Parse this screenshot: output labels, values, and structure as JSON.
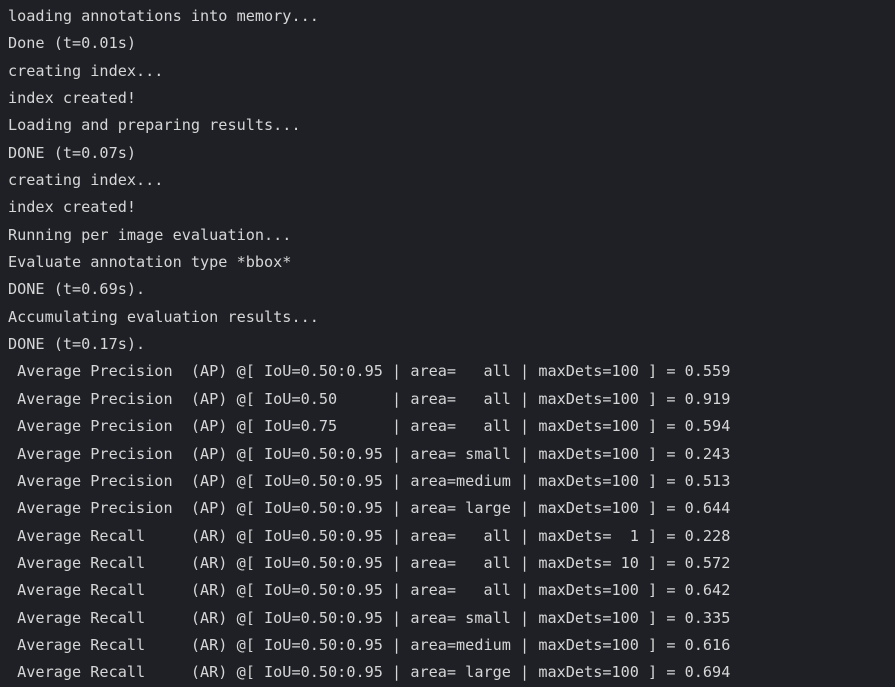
{
  "terminal": {
    "background_color": "#1e2025",
    "text_color": "#d6d6d6",
    "lines": [
      {
        "text": "loading annotations into memory..."
      },
      {
        "text": "Done (t=0.01s)"
      },
      {
        "text": "creating index..."
      },
      {
        "text": "index created!"
      },
      {
        "text": "Loading and preparing results..."
      },
      {
        "text": "DONE (t=0.07s)"
      },
      {
        "text": "creating index..."
      },
      {
        "text": "index created!"
      },
      {
        "text": "Running per image evaluation..."
      },
      {
        "text": "Evaluate annotation type *bbox*"
      },
      {
        "text": "DONE (t=0.69s)."
      },
      {
        "text": "Accumulating evaluation results..."
      },
      {
        "text": "DONE (t=0.17s)."
      },
      {
        "text": " Average Precision  (AP) @[ IoU=0.50:0.95 | area=   all | maxDets=100 ] = 0.559"
      },
      {
        "text": " Average Precision  (AP) @[ IoU=0.50      | area=   all | maxDets=100 ] = 0.919"
      },
      {
        "text": " Average Precision  (AP) @[ IoU=0.75      | area=   all | maxDets=100 ] = 0.594"
      },
      {
        "text": " Average Precision  (AP) @[ IoU=0.50:0.95 | area= small | maxDets=100 ] = 0.243"
      },
      {
        "text": " Average Precision  (AP) @[ IoU=0.50:0.95 | area=medium | maxDets=100 ] = 0.513"
      },
      {
        "text": " Average Precision  (AP) @[ IoU=0.50:0.95 | area= large | maxDets=100 ] = 0.644"
      },
      {
        "text": " Average Recall     (AR) @[ IoU=0.50:0.95 | area=   all | maxDets=  1 ] = 0.228"
      },
      {
        "text": " Average Recall     (AR) @[ IoU=0.50:0.95 | area=   all | maxDets= 10 ] = 0.572"
      },
      {
        "text": " Average Recall     (AR) @[ IoU=0.50:0.95 | area=   all | maxDets=100 ] = 0.642"
      },
      {
        "text": " Average Recall     (AR) @[ IoU=0.50:0.95 | area= small | maxDets=100 ] = 0.335"
      },
      {
        "text": " Average Recall     (AR) @[ IoU=0.50:0.95 | area=medium | maxDets=100 ] = 0.616"
      },
      {
        "text": " Average Recall     (AR) @[ IoU=0.50:0.95 | area= large | maxDets=100 ] = 0.694"
      }
    ]
  },
  "metrics": {
    "ap": [
      {
        "label": "Average Precision",
        "abbr": "AP",
        "iou": "0.50:0.95",
        "area": "all",
        "maxDets": "100",
        "value": "0.559"
      },
      {
        "label": "Average Precision",
        "abbr": "AP",
        "iou": "0.50",
        "area": "all",
        "maxDets": "100",
        "value": "0.919"
      },
      {
        "label": "Average Precision",
        "abbr": "AP",
        "iou": "0.75",
        "area": "all",
        "maxDets": "100",
        "value": "0.594"
      },
      {
        "label": "Average Precision",
        "abbr": "AP",
        "iou": "0.50:0.95",
        "area": "small",
        "maxDets": "100",
        "value": "0.243"
      },
      {
        "label": "Average Precision",
        "abbr": "AP",
        "iou": "0.50:0.95",
        "area": "medium",
        "maxDets": "100",
        "value": "0.513"
      },
      {
        "label": "Average Precision",
        "abbr": "AP",
        "iou": "0.50:0.95",
        "area": "large",
        "maxDets": "100",
        "value": "0.644"
      }
    ],
    "ar": [
      {
        "label": "Average Recall",
        "abbr": "AR",
        "iou": "0.50:0.95",
        "area": "all",
        "maxDets": "1",
        "value": "0.228"
      },
      {
        "label": "Average Recall",
        "abbr": "AR",
        "iou": "0.50:0.95",
        "area": "all",
        "maxDets": "10",
        "value": "0.572"
      },
      {
        "label": "Average Recall",
        "abbr": "AR",
        "iou": "0.50:0.95",
        "area": "all",
        "maxDets": "100",
        "value": "0.642"
      },
      {
        "label": "Average Recall",
        "abbr": "AR",
        "iou": "0.50:0.95",
        "area": "small",
        "maxDets": "100",
        "value": "0.335"
      },
      {
        "label": "Average Recall",
        "abbr": "AR",
        "iou": "0.50:0.95",
        "area": "medium",
        "maxDets": "100",
        "value": "0.616"
      },
      {
        "label": "Average Recall",
        "abbr": "AR",
        "iou": "0.50:0.95",
        "area": "large",
        "maxDets": "100",
        "value": "0.694"
      }
    ],
    "timings": {
      "load_annotations": "0.01s",
      "load_results": "0.07s",
      "evaluate": "0.69s",
      "accumulate": "0.17s"
    },
    "annotation_type": "bbox"
  }
}
